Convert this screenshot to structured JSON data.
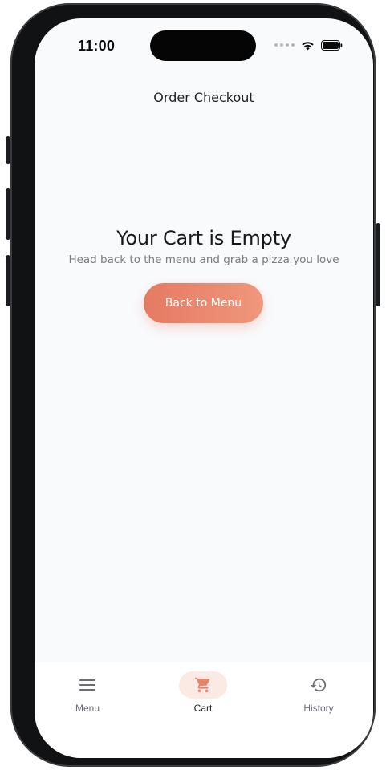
{
  "status_bar": {
    "time": "11:00"
  },
  "header": {
    "title": "Order Checkout"
  },
  "empty_state": {
    "title": "Your Cart is Empty",
    "subtitle": "Head back to the menu and grab a pizza you love",
    "button_label": "Back to Menu"
  },
  "tab_bar": {
    "active_tab": "cart",
    "tabs": [
      {
        "key": "menu",
        "label": "Menu",
        "icon": "hamburger-menu-icon"
      },
      {
        "key": "cart",
        "label": "Cart",
        "icon": "shopping-cart-icon"
      },
      {
        "key": "history",
        "label": "History",
        "icon": "history-icon"
      }
    ]
  },
  "colors": {
    "accent": "#e8826a",
    "active_tab_bg": "#fbe9e4",
    "inactive_icon": "#6b6e75",
    "screen_bg": "#f9fafc"
  }
}
